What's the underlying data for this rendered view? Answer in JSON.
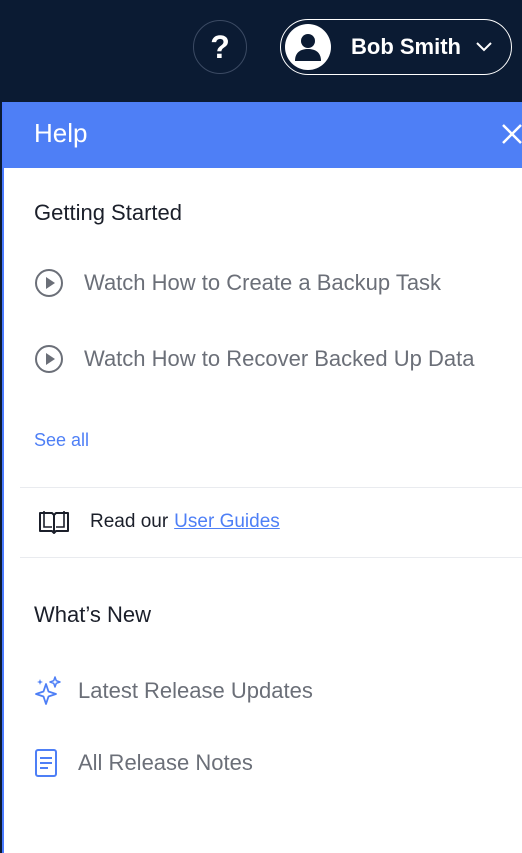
{
  "topbar": {
    "help_symbol": "?",
    "user_name": "Bob Smith"
  },
  "panel": {
    "title": "Help",
    "getting_started": {
      "title": "Getting Started",
      "items": [
        {
          "label": "Watch How to Create a Backup Task",
          "icon": "play-circle-icon"
        },
        {
          "label": "Watch How to Recover Backed Up Data",
          "icon": "play-circle-icon"
        }
      ],
      "see_all": "See all"
    },
    "guides": {
      "prefix": "Read our",
      "link": "User Guides",
      "icon": "open-book-icon"
    },
    "whats_new": {
      "title": "What’s New",
      "items": [
        {
          "label": "Latest Release Updates",
          "icon": "sparkle-icon"
        },
        {
          "label": "All Release Notes",
          "icon": "document-icon"
        }
      ]
    }
  },
  "colors": {
    "topbar_bg": "#0b1b33",
    "header_blue": "#4e7ff6",
    "link_blue": "#4e7ff6",
    "muted_text": "#6b6f78"
  }
}
